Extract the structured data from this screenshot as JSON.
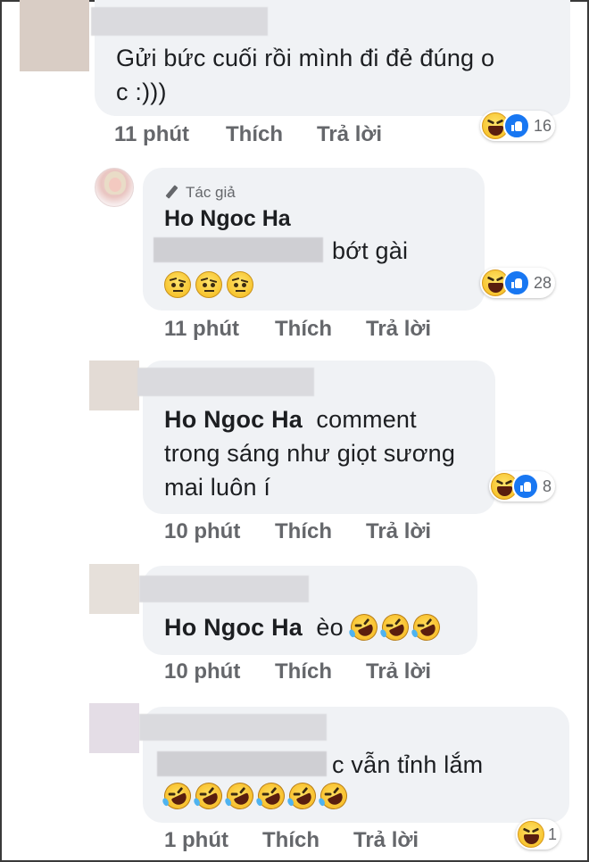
{
  "colors": {
    "bubble_bg": "#f0f2f5",
    "meta_text": "#65676b",
    "like_blue": "#1877f2",
    "haha_yellow": "#f7c531"
  },
  "comments": [
    {
      "text": "Gửi bức cuối rồi mình đi đẻ đúng o c :)))",
      "line1": "Gửi bức cuối rồi mình đi đẻ đúng o",
      "line2": "c :)))",
      "time": "11 phút",
      "like": "Thích",
      "reply": "Trả lời",
      "reaction_count": "16",
      "reaction_icons": [
        "haha-icon",
        "like-icon"
      ]
    },
    {
      "badge": "Tác giả",
      "author": "Ho Ngoc Ha",
      "text": "bớt gài",
      "inline_emojis": [
        "raised-eyebrow-emoji",
        "raised-eyebrow-emoji",
        "raised-eyebrow-emoji"
      ],
      "time": "11 phút",
      "like": "Thích",
      "reply": "Trả lời",
      "reaction_count": "28",
      "reaction_icons": [
        "haha-icon",
        "like-icon"
      ]
    },
    {
      "mention": "Ho Ngoc Ha",
      "line1": "comment",
      "line2": "trong sáng như giọt sương",
      "line3": "mai luôn í",
      "time": "10 phút",
      "like": "Thích",
      "reply": "Trả lời",
      "reaction_count": "8",
      "reaction_icons": [
        "haha-icon",
        "like-icon"
      ]
    },
    {
      "mention": "Ho Ngoc Ha",
      "text": "èo",
      "inline_emojis": [
        "rofl-emoji",
        "rofl-emoji",
        "rofl-emoji"
      ],
      "time": "10 phút",
      "like": "Thích",
      "reply": "Trả lời"
    },
    {
      "text": "c vẫn tỉnh lắm",
      "inline_emojis": [
        "rofl-emoji",
        "rofl-emoji",
        "rofl-emoji",
        "rofl-emoji",
        "rofl-emoji",
        "rofl-emoji"
      ],
      "time": "1 phút",
      "like": "Thích",
      "reply": "Trả lời",
      "reaction_count": "1",
      "reaction_icons": [
        "haha-icon"
      ]
    }
  ]
}
